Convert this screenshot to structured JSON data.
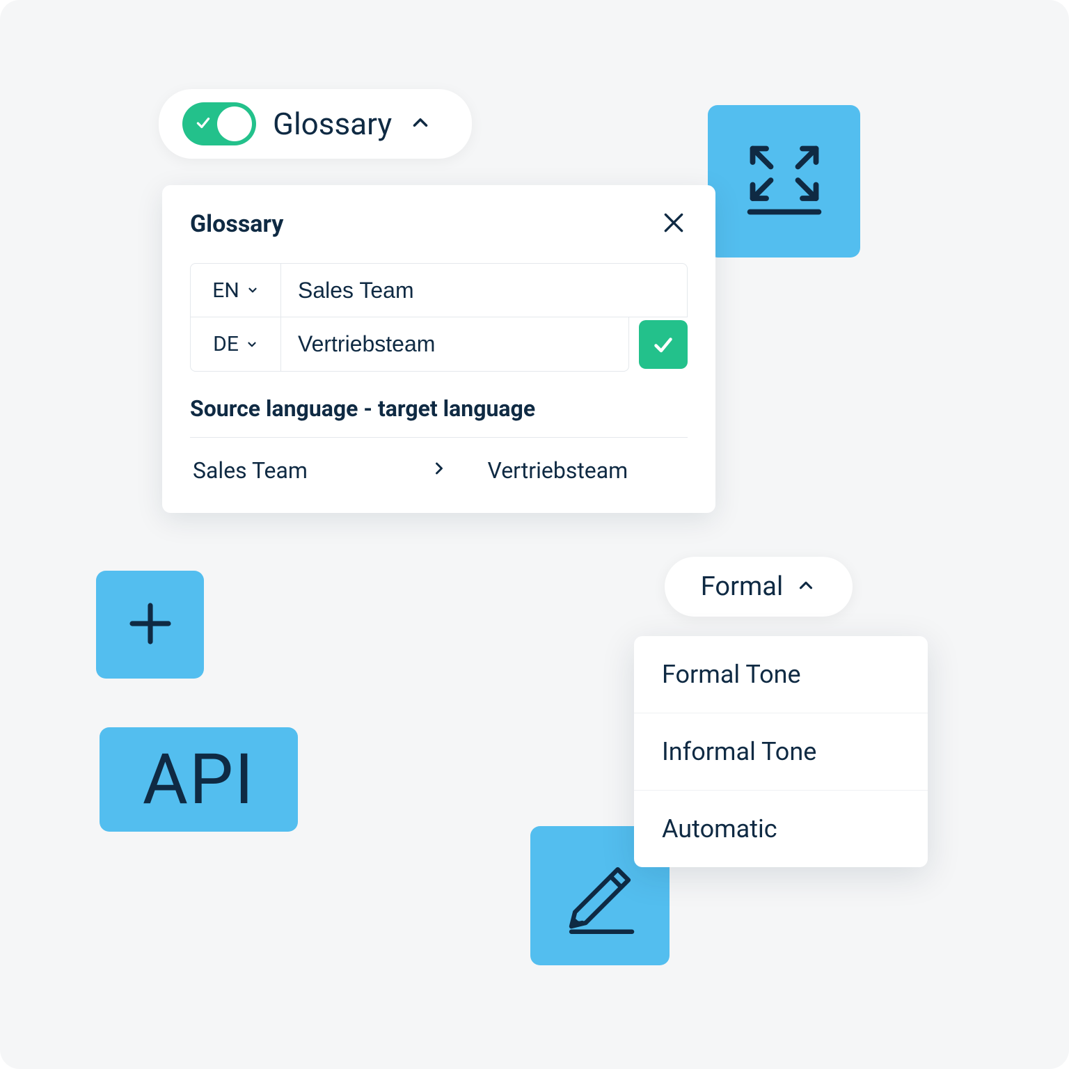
{
  "glossaryToggle": {
    "label": "Glossary",
    "enabled": true
  },
  "glossaryCard": {
    "title": "Glossary",
    "sourceLang": "EN",
    "targetLang": "DE",
    "sourceTerm": "Sales Team",
    "targetTerm": "Vertriebsteam",
    "mappingLabel": "Source language - target language",
    "mapping": {
      "source": "Sales Team",
      "target": "Vertriebsteam"
    }
  },
  "apiTile": {
    "label": "API"
  },
  "tone": {
    "selected": "Formal",
    "options": [
      "Formal Tone",
      "Informal Tone",
      "Automatic"
    ]
  },
  "colors": {
    "blue": "#53beef",
    "green": "#23c18b",
    "text": "#0f2a43"
  }
}
